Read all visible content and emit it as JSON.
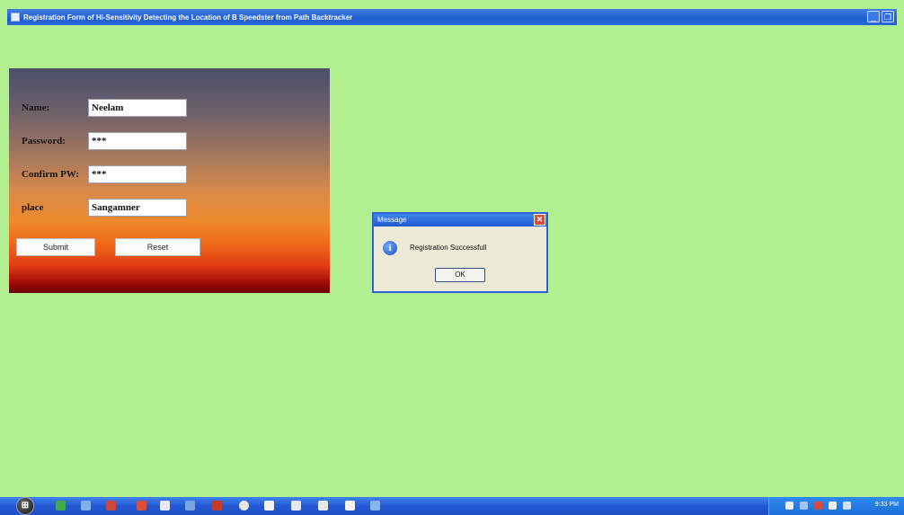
{
  "window": {
    "title": "Registration Form of Hi-Sensitivity Detecting the Location of B Speedster from Path Backtracker"
  },
  "form": {
    "name_label": "Name:",
    "name_value": "Neelam",
    "password_label": "Password:",
    "password_value": "***",
    "confirm_label": "Confirm PW:",
    "confirm_value": "***",
    "place_label": "place",
    "place_value": "Sangamner",
    "submit_label": "Submit",
    "reset_label": "Reset"
  },
  "dialog": {
    "title": "Message",
    "message": "Registration Successfull",
    "ok_label": "OK"
  },
  "taskbar": {
    "clock": "9:33 PM"
  },
  "colors": {
    "background": "#b1ef91",
    "titlebar": "#2a66d6",
    "taskbar": "#2459d4"
  }
}
